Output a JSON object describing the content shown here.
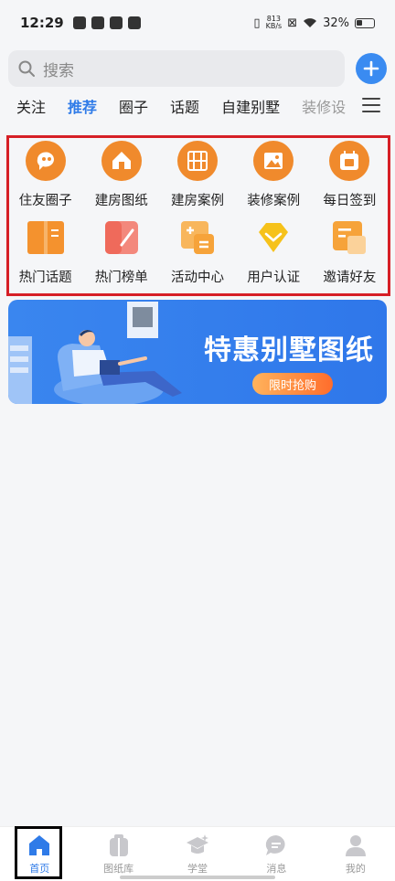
{
  "status_bar": {
    "time": "12:29",
    "net_speed": "813\nKB/s",
    "battery": "32%"
  },
  "search": {
    "placeholder": "搜索"
  },
  "tabs": [
    "关注",
    "推荐",
    "圈子",
    "话题",
    "自建别墅",
    "装修设"
  ],
  "grid": [
    {
      "label": "住友圈子",
      "icon": "chat-bubble-icon",
      "color": "#f08a2c"
    },
    {
      "label": "建房图纸",
      "icon": "house-icon",
      "color": "#f08a2c"
    },
    {
      "label": "建房案例",
      "icon": "blueprint-icon",
      "color": "#f08a2c"
    },
    {
      "label": "装修案例",
      "icon": "picture-icon",
      "color": "#f08a2c"
    },
    {
      "label": "每日签到",
      "icon": "calendar-sign-icon",
      "color": "#f08a2c"
    },
    {
      "label": "热门话题",
      "icon": "book-icon",
      "color": "#f4922e"
    },
    {
      "label": "热门榜单",
      "icon": "ranking-card-icon",
      "color": "#ef6a5b"
    },
    {
      "label": "活动中心",
      "icon": "calculator-icon",
      "color": "#f6a33a"
    },
    {
      "label": "用户认证",
      "icon": "diamond-icon",
      "color": "#f6c21b"
    },
    {
      "label": "邀请好友",
      "icon": "invite-card-icon",
      "color": "#f6a33a"
    }
  ],
  "banner": {
    "title": "特惠别墅图纸",
    "button": "限时抢购"
  },
  "bottom_nav": [
    {
      "label": "首页",
      "icon": "home-icon"
    },
    {
      "label": "图纸库",
      "icon": "drawings-icon"
    },
    {
      "label": "学堂",
      "icon": "graduation-cap-icon"
    },
    {
      "label": "消息",
      "icon": "message-icon"
    },
    {
      "label": "我的",
      "icon": "profile-icon"
    }
  ],
  "colors": {
    "accent": "#2f7be8",
    "highlight_frame": "#d61f26",
    "icon_orange": "#f08a2c"
  }
}
